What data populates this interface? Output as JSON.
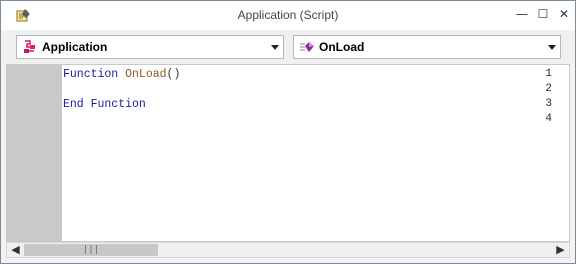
{
  "window": {
    "title": "Application (Script)",
    "minimize_glyph": "—",
    "maximize_glyph": "☐",
    "close_glyph": "✕"
  },
  "toolbar": {
    "object_select": {
      "selected": "Application",
      "icon": "application-object-icon"
    },
    "procedure_select": {
      "selected": "OnLoad",
      "icon": "event-method-icon"
    }
  },
  "editor": {
    "lines": [
      {
        "number": "1",
        "tokens": [
          {
            "t": "kw",
            "text": "Function "
          },
          {
            "t": "fn",
            "text": "OnLoad"
          },
          {
            "t": "pn",
            "text": "()"
          }
        ]
      },
      {
        "number": "2",
        "tokens": []
      },
      {
        "number": "3",
        "tokens": [
          {
            "t": "kw",
            "text": "End Function"
          }
        ]
      },
      {
        "number": "4",
        "tokens": []
      }
    ]
  },
  "scrollbar": {
    "left_glyph": "◀",
    "right_glyph": "▶",
    "thumb_grip": "|||"
  }
}
